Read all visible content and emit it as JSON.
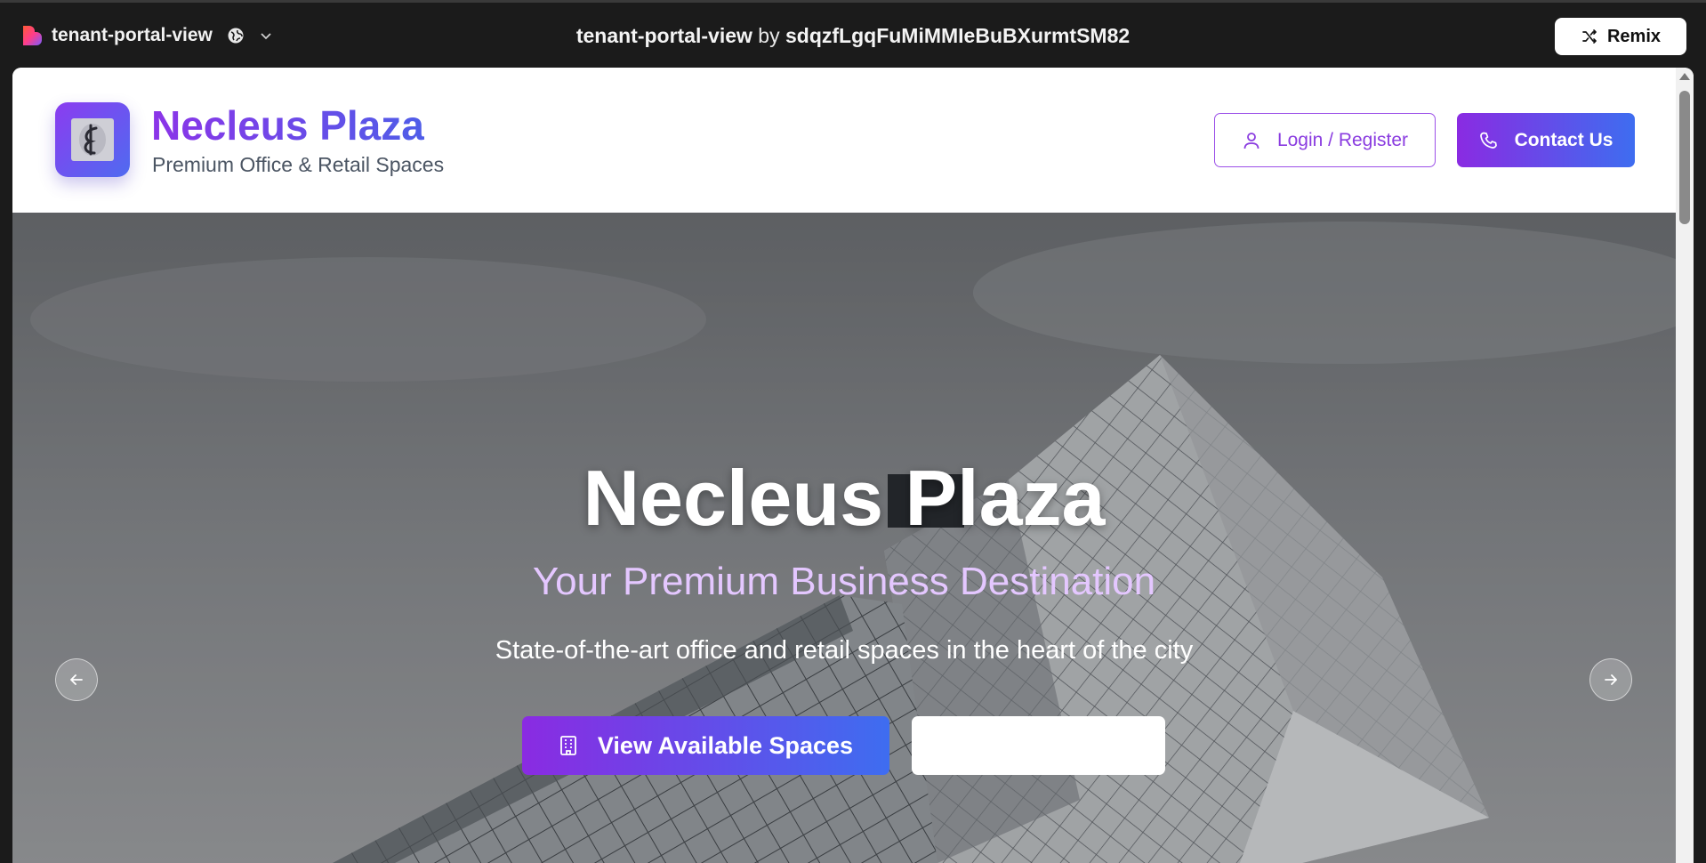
{
  "chrome": {
    "app_name": "tenant-portal-view",
    "title_project": "tenant-portal-view",
    "title_by": " by ",
    "title_user": "sdqzfLgqFuMiMMIeBuBXurmtSM82",
    "remix_label": "Remix",
    "icons": [
      "app-logo-icon",
      "globe-icon",
      "chevron-down-icon",
      "shuffle-icon"
    ]
  },
  "header": {
    "brand_name": "Necleus Plaza",
    "tagline": "Premium Office & Retail Spaces",
    "login_label": "Login / Register",
    "contact_label": "Contact Us"
  },
  "hero": {
    "title": "Necleus Plaza",
    "subtitle": "Your Premium Business Destination",
    "description": "State-of-the-art office and retail spaces in the heart of the city",
    "primary_button": "View Available Spaces",
    "secondary_button": ""
  },
  "colors": {
    "accent_purple": "#8a2be2",
    "accent_blue": "#3e6df0",
    "subtitle_lilac": "#e4c7ff"
  }
}
